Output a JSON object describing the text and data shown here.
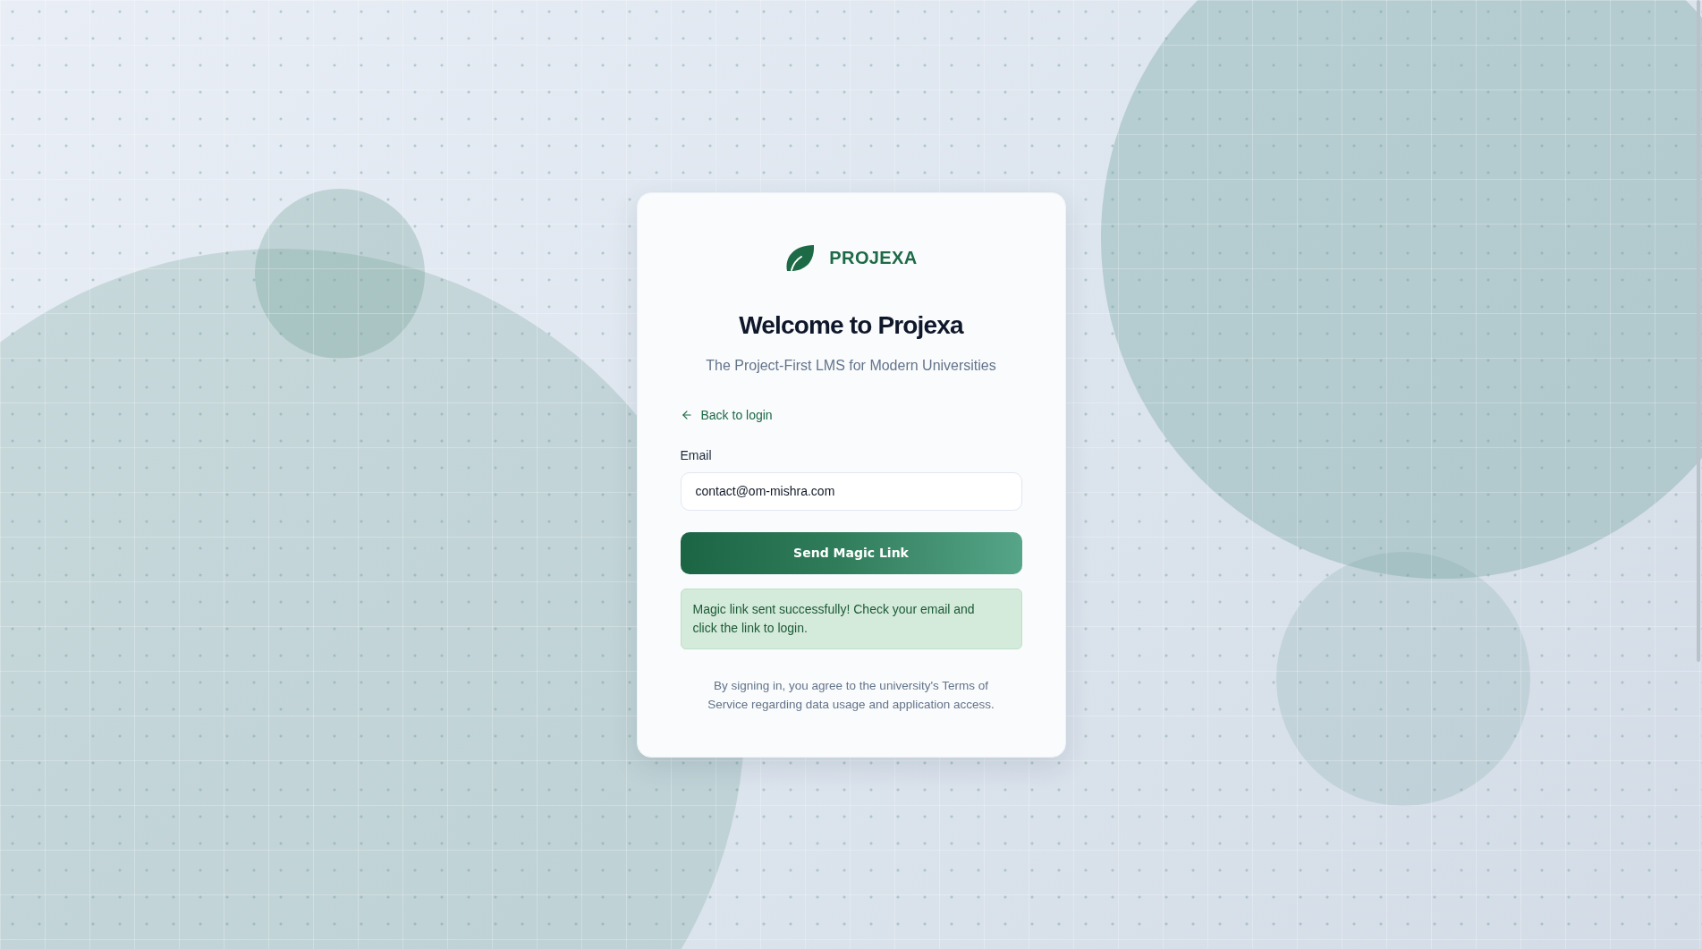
{
  "brand": {
    "name": "PROJEXA"
  },
  "heading": "Welcome to Projexa",
  "subtitle": "The Project-First LMS for Modern Universities",
  "back_link": {
    "label": "Back to login"
  },
  "email": {
    "label": "Email",
    "value": "contact@om-mishra.com"
  },
  "submit_button": {
    "label": "Send Magic Link"
  },
  "alert": {
    "kind": "success",
    "text": "Magic link sent successfully! Check your email and click the link to login."
  },
  "footer_note": "By signing in, you agree to the university's Terms of Service regarding data usage and application access."
}
